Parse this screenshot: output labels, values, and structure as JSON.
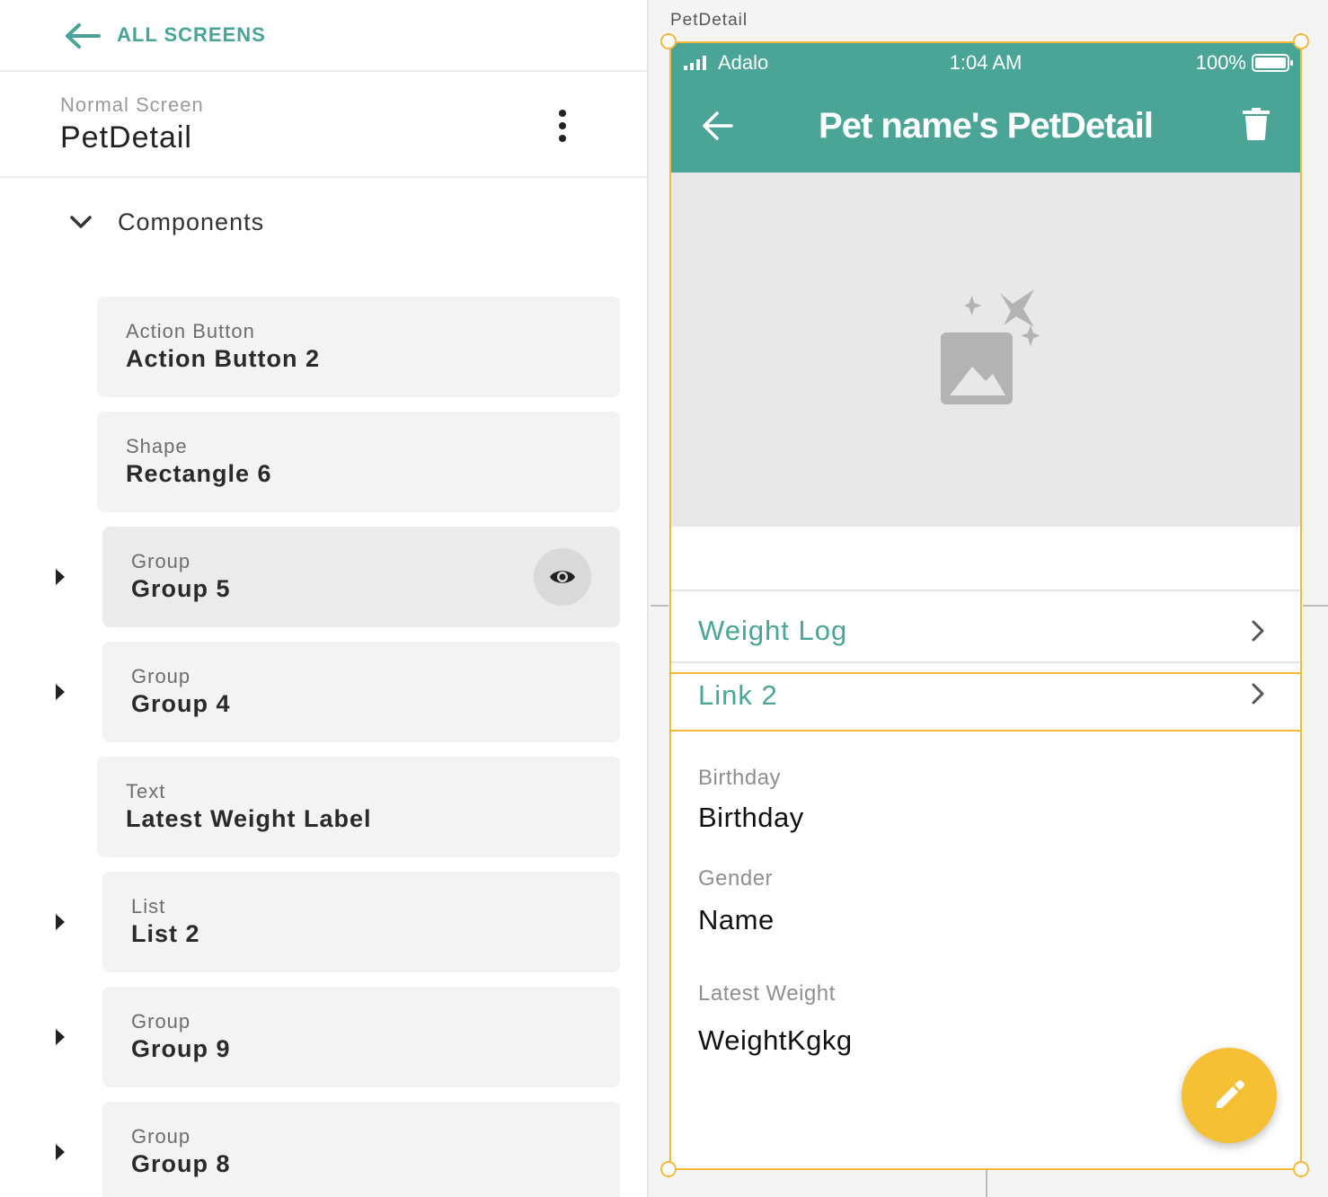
{
  "sidebar": {
    "all_screens_label": "ALL SCREENS",
    "screen_type": "Normal Screen",
    "screen_name": "PetDetail",
    "components_label": "Components",
    "items": [
      {
        "type": "Action Button",
        "name": "Action Button 2",
        "expandable": false
      },
      {
        "type": "Shape",
        "name": "Rectangle 6",
        "expandable": false
      },
      {
        "type": "Group",
        "name": "Group 5",
        "expandable": true,
        "hovered": true
      },
      {
        "type": "Group",
        "name": "Group 4",
        "expandable": true
      },
      {
        "type": "Text",
        "name": "Latest Weight Label",
        "expandable": false
      },
      {
        "type": "List",
        "name": "List 2",
        "expandable": true
      },
      {
        "type": "Group",
        "name": "Group 9",
        "expandable": true
      },
      {
        "type": "Group",
        "name": "Group 8",
        "expandable": true
      }
    ]
  },
  "canvas": {
    "screen_label": "PetDetail"
  },
  "phone": {
    "status": {
      "carrier": "Adalo",
      "time": "1:04 AM",
      "battery": "100%"
    },
    "appbar_title": "Pet name's PetDetail",
    "links": [
      {
        "label": "Weight Log"
      },
      {
        "label": "Link 2"
      }
    ],
    "fields": [
      {
        "label": "Birthday",
        "value": "Birthday"
      },
      {
        "label": "Gender",
        "value": "Name"
      },
      {
        "label": "Latest Weight",
        "value": "WeightKgkg"
      }
    ]
  },
  "colors": {
    "accent": "#4aa597",
    "selection": "#f2b93b",
    "fab": "#f5c033"
  },
  "icons": [
    "arrow-left-icon",
    "more-vertical-icon",
    "chevron-down-icon",
    "caret-right-icon",
    "eye-icon",
    "signal-icon",
    "battery-icon",
    "trash-icon",
    "image-placeholder-icon",
    "chevron-right-icon",
    "pencil-icon"
  ]
}
